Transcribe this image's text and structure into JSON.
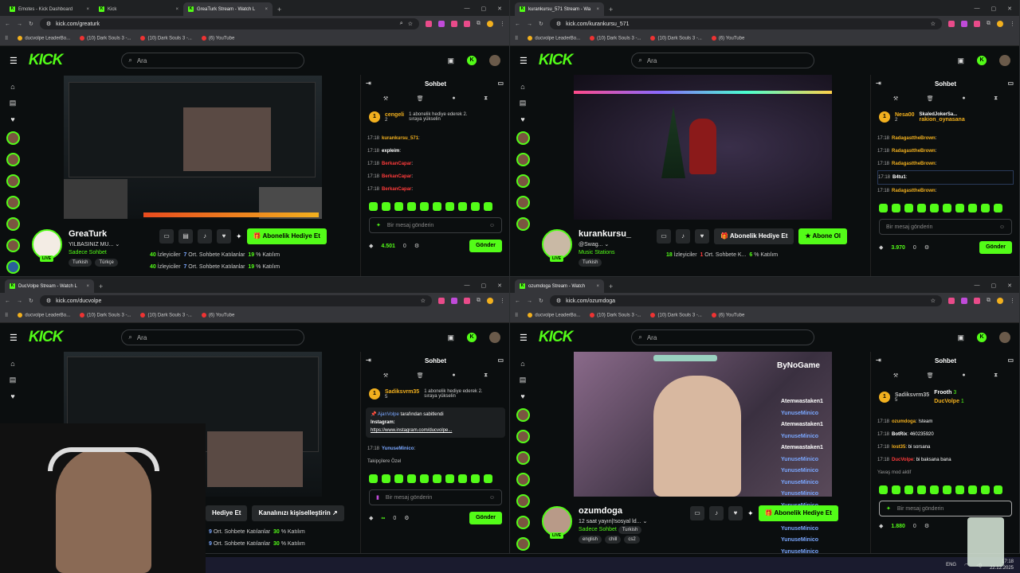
{
  "windows": [
    {
      "tabs": [
        "Emotes - Kick Dashboard",
        "Kick",
        "GreaTurk Stream - Watch L"
      ],
      "active_tab": 2,
      "url": "kick.com/greaturk",
      "bookmarks": [
        "ducvolpe LeaderBo...",
        "(10) Dark Souls 3 -...",
        "(10) Dark Souls 3 -...",
        "(6) YouTube"
      ],
      "search_placeholder": "Ara",
      "streamer": {
        "name": "GreaTurk",
        "title": "YILBASINIZ MU...",
        "category": "Sadece Sohbet",
        "tags": [
          "Turkish",
          "Türkçe"
        ]
      },
      "buttons": {
        "subscribe_gift": "Abonelik Hediye Et"
      },
      "stats": [
        {
          "viewers": "40",
          "viewers_label": "İzleyiciler",
          "chatters": "7",
          "chatters_label": "Ort. Sohbete Katılanlar",
          "participation": "19",
          "participation_label": "% Katılım"
        },
        {
          "viewers": "40",
          "viewers_label": "İzleyiciler",
          "chatters": "7",
          "chatters_label": "Ort. Sohbete Katılanlar",
          "participation": "19",
          "participation_label": "% Katılım"
        }
      ],
      "chat": {
        "title": "Sohbet",
        "gift": {
          "user": "cengeli",
          "count": "2",
          "text": "1 abonelik hediye ederek 2. sıraya yükselin"
        },
        "messages": [
          {
            "time": "17:18",
            "user": "kurankursu_571",
            "text": ":",
            "color": "#f2b01e"
          },
          {
            "time": "17:18",
            "user": "expleim",
            "text": ":",
            "color": "#ffffff"
          },
          {
            "time": "17:18",
            "user": "BerkanCapar",
            "text": ":",
            "color": "#ff3b3b"
          },
          {
            "time": "17:18",
            "user": "BerkanCapar",
            "text": ":",
            "color": "#ff3b3b"
          },
          {
            "time": "17:18",
            "user": "BerkanCapar",
            "text": ":",
            "color": "#ff3b3b"
          }
        ],
        "input_placeholder": "Bir mesaj gönderin",
        "points": "4.501",
        "count": "0",
        "send": "Gönder"
      }
    },
    {
      "tabs": [
        "kurankursu_571 Stream - Wa"
      ],
      "active_tab": 0,
      "url": "kick.com/kurankursu_571",
      "bookmarks": [
        "ducvolpe LeaderBo...",
        "(10) Dark Souls 3 -...",
        "(10) Dark Souls 3 -...",
        "(6) YouTube"
      ],
      "search_placeholder": "Ara",
      "streamer": {
        "name": "kurankursu_",
        "title": "@Swag...",
        "category": "Music Stations",
        "tags": [
          "Turkish"
        ]
      },
      "buttons": {
        "subscribe_gift": "Abonelik Hediye Et",
        "subscribe": "Abone Ol"
      },
      "stats": [
        {
          "viewers": "18",
          "viewers_label": "İzleyiciler",
          "chatters": "1",
          "chatters_label": "Ort. Sohbete K...",
          "participation": "6",
          "participation_label": "% Katılım"
        }
      ],
      "chat": {
        "title": "Sohbet",
        "gift": {
          "user": "Nesa00",
          "count": "2",
          "text": "SkaledJokerSa...",
          "text2": "rakion_oynasana"
        },
        "messages": [
          {
            "time": "17:18",
            "user": "RadagasttheBrown",
            "text": ":",
            "color": "#f2b01e"
          },
          {
            "time": "17:18",
            "user": "RadagasttheBrown",
            "text": ":",
            "color": "#f2b01e"
          },
          {
            "time": "17:18",
            "user": "RadagasttheBrown",
            "text": ":",
            "color": "#f2b01e"
          },
          {
            "time": "17:18",
            "user": "B4tu1",
            "text": ":",
            "color": "#ffffff"
          },
          {
            "time": "17:18",
            "user": "RadagasttheBrown",
            "text": ":",
            "color": "#f2b01e"
          }
        ],
        "input_placeholder": "Bir mesaj gönderin",
        "points": "3.970",
        "count": "0",
        "send": "Gönder"
      }
    },
    {
      "tabs": [
        "DucVolpe Stream - Watch L"
      ],
      "active_tab": 0,
      "url": "kick.com/ducvolpe",
      "bookmarks": [
        "ducvolpe LeaderBo...",
        "(10) Dark Souls 3 -...",
        "(10) Dark Souls 3 -...",
        "(6) YouTube"
      ],
      "search_placeholder": "Ara",
      "buttons": {
        "subscribe_gift": "Hediye Et",
        "customize": "Kanalınızı kişiselleştirin"
      },
      "stats": [
        {
          "viewers": "",
          "viewers_label": "",
          "chatters": "9",
          "chatters_label": "Ort. Sohbete Katılanlar",
          "participation": "30",
          "participation_label": "% Katılım"
        },
        {
          "viewers": "",
          "viewers_label": "",
          "chatters": "9",
          "chatters_label": "Ort. Sohbete Katılanlar",
          "participation": "30",
          "participation_label": "% Katılım"
        }
      ],
      "chat": {
        "title": "Sohbet",
        "gift": {
          "user": "Sadiksvrm35",
          "count": "5",
          "text": "1 abonelik hediye ederek 2. sıraya yükselin"
        },
        "pinned": {
          "by": "AjanVolpe",
          "by_suffix": "tarafından sabitlendi",
          "label": "Instagram:",
          "link": "https://www.instagram.com/ducvolpe..."
        },
        "messages": [
          {
            "time": "17:18",
            "user": "YunuseMinico",
            "text": ":",
            "color": "#7aa7ff"
          }
        ],
        "followers_note": "Takipçilere Özel",
        "input_placeholder": "Bir mesaj gönderin",
        "points": "∞",
        "count": "0",
        "send": "Gönder"
      }
    },
    {
      "tabs": [
        "ozumdoga Stream - Watch"
      ],
      "active_tab": 0,
      "url": "kick.com/ozumdoga",
      "bookmarks": [
        "ducvolpe LeaderBo...",
        "(10) Dark Souls 3 -...",
        "(10) Dark Souls 3 -...",
        "(6) YouTube"
      ],
      "search_placeholder": "Ara",
      "streamer": {
        "name": "ozumdoga",
        "title": "12 saat yayın|!sosyal ld...",
        "category": "Sadece Sohbet",
        "tags": [
          "Turkish",
          "english",
          "chill",
          "cs2"
        ]
      },
      "buttons": {
        "subscribe_gift": "Abonelik Hediye Et"
      },
      "overlay_brand": "ByNoGame",
      "overlay_chat": [
        "Atemwastaken1",
        "YunuseMinico",
        "Atemwastaken1",
        "YunuseMinico",
        "Atemwastaken1",
        "YunuseMinico",
        "YunuseMinico",
        "YunuseMinico",
        "YunuseMinico",
        "YunuseMinico",
        "YunuseMinico",
        "YunuseMinico",
        "YunuseMinico",
        "YunuseMinico"
      ],
      "chat": {
        "title": "Sohbet",
        "gift": {
          "user": "Sadiksvrm35",
          "count": "5",
          "text": "Frooth",
          "text_count": "3",
          "text2": "DucVolpe",
          "text2_count": "1"
        },
        "messages": [
          {
            "time": "17:18",
            "user": "ozumdoga",
            "text": ": !steam",
            "color": "#f2b01e"
          },
          {
            "time": "17:18",
            "user": "BotRix",
            "text": ": 460235920",
            "color": "#ffffff"
          },
          {
            "time": "17:18",
            "user": "lost35",
            "text": ": bi sorsana",
            "color": "#f2b01e"
          },
          {
            "time": "17:18",
            "user": "DucVolpe",
            "text": ": bi baksana bana",
            "color": "#ff3b3b"
          }
        ],
        "mod_note": "Yavaş mod aktif",
        "input_placeholder": "Bir mesaj gönderin",
        "points": "1.880",
        "count": "0"
      }
    }
  ],
  "taskbar": {
    "lang": "ENG",
    "time": "17:18",
    "date": "22.12.2025"
  },
  "colors": {
    "kick_green": "#53fc18",
    "bg": "#0b0e0f",
    "gold": "#f2b01e"
  }
}
